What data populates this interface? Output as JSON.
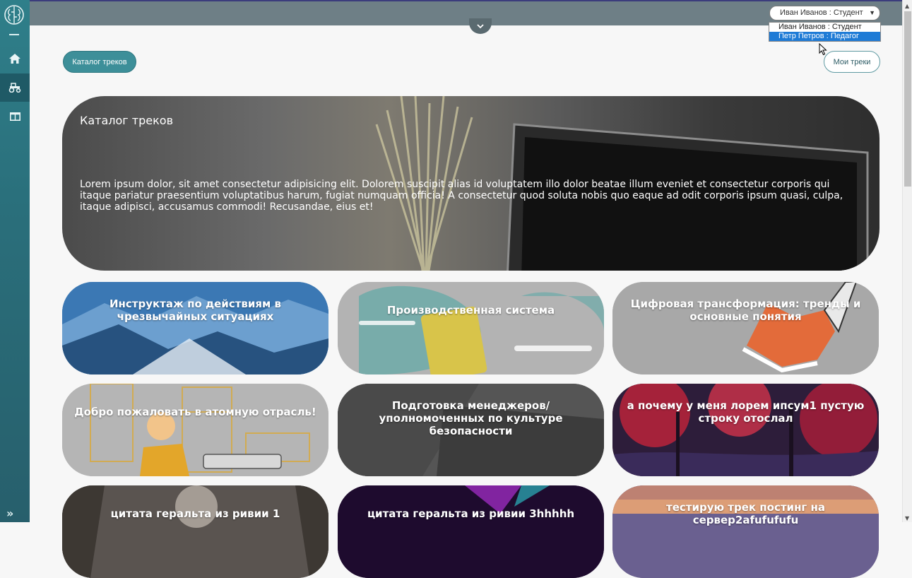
{
  "user_switcher": {
    "selected": "Иван Иванов : Студент",
    "options": [
      "Иван Иванов : Студент",
      "Петр Петров : Педагог"
    ],
    "highlighted": "Петр Петров : Педагог"
  },
  "nav": {
    "catalog_button": "Каталог треков",
    "my_tracks_button": "Мои треки"
  },
  "hero": {
    "title": "Каталог треков",
    "text": "Lorem ipsum dolor, sit amet consectetur adipisicing elit. Dolorem suscipit alias id voluptatem illo dolor beatae illum eveniet et consectetur corporis qui itaque pariatur praesentium voluptatibus harum, fugiat numquam officia! A consectetur quod soluta nobis quo eaque ad odit corporis ipsum quasi, culpa, itaque adipisci, accusamus commodi! Recusandae, eius et!"
  },
  "tracks": [
    {
      "title": "Инструктаж по действиям в чрезвычайных ситуациях"
    },
    {
      "title": "Производственная система"
    },
    {
      "title": "Цифровая трансформация: тренды и основные понятия"
    },
    {
      "title": "Добро пожаловать в атомную отрасль!"
    },
    {
      "title": "Подготовка менеджеров/уполномоченных по культуре безопасности"
    },
    {
      "title": "а почему у меня лорем ипсум1 пустую строку отослал"
    },
    {
      "title": "цитата геральта из ривии 1"
    },
    {
      "title": "цитата геральта из ривии 3hhhhh"
    },
    {
      "title": "тестирую трек постинг на сервер2afufufufu"
    }
  ],
  "colors": {
    "sidebar": "#2a6f7b",
    "accent": "#3d8f99",
    "topbar": "#6e7f86",
    "selection": "#1e7bd6"
  },
  "icons": {
    "logo": "brain-icon",
    "home": "home-icon",
    "tracks": "tractor-icon",
    "catalog": "book-icon",
    "expand": "double-chevron-right-icon"
  }
}
